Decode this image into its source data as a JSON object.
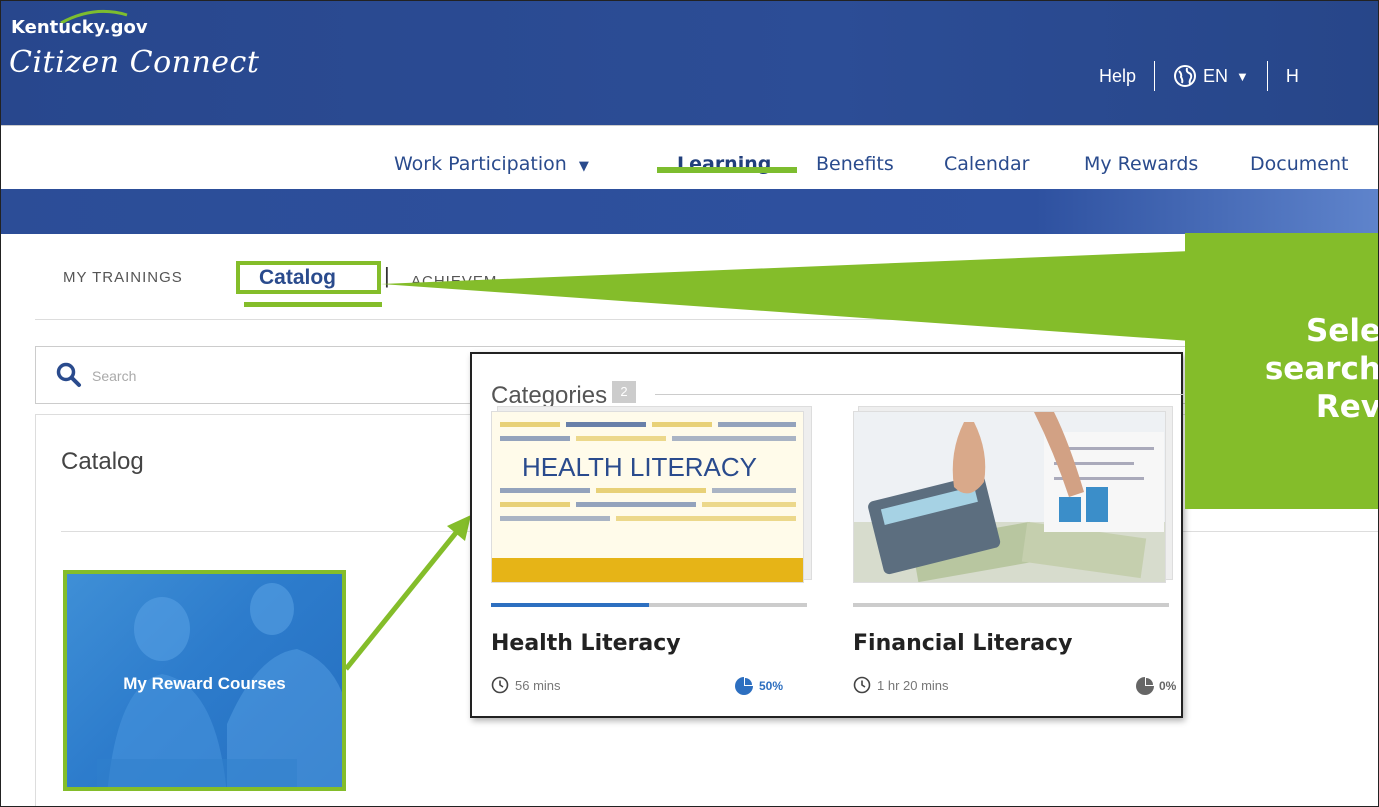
{
  "header": {
    "brand_top": "Kentucky.gov",
    "brand_script": "Citizen Connect",
    "help": "Help",
    "language": "EN",
    "cut_item": "H"
  },
  "nav": {
    "items": [
      "Work Participation",
      "Learning",
      "Benefits",
      "Calendar",
      "My Rewards",
      "Document"
    ],
    "active": "Learning"
  },
  "tabs": {
    "my_trainings": "MY TRAININGS",
    "catalog": "Catalog",
    "separator": "|",
    "achievements": "ACHIEVEM"
  },
  "search": {
    "placeholder": "Search"
  },
  "catalog_panel": {
    "title": "Catalog",
    "reward_card_label": "My Reward Courses"
  },
  "categories": {
    "title": "Categories",
    "count": "2",
    "items": [
      {
        "name": "Health Literacy",
        "duration": "56 mins",
        "percent": "50%",
        "progress": 0.5,
        "thumb_text": "HEALTH LITERACY"
      },
      {
        "name": "Financial Literacy",
        "duration": "1 hr 20 mins",
        "percent": "0%",
        "progress": 0
      }
    ]
  },
  "callout": {
    "lines": [
      "Sele",
      "search",
      "Rev"
    ]
  },
  "colors": {
    "header": "#2c4d96",
    "accent_green": "#84bd2a",
    "link_blue": "#2a4b8d"
  },
  "icons": [
    "globe-icon",
    "search-icon",
    "clock-icon",
    "pie-chart-icon",
    "chevron-down-icon"
  ]
}
